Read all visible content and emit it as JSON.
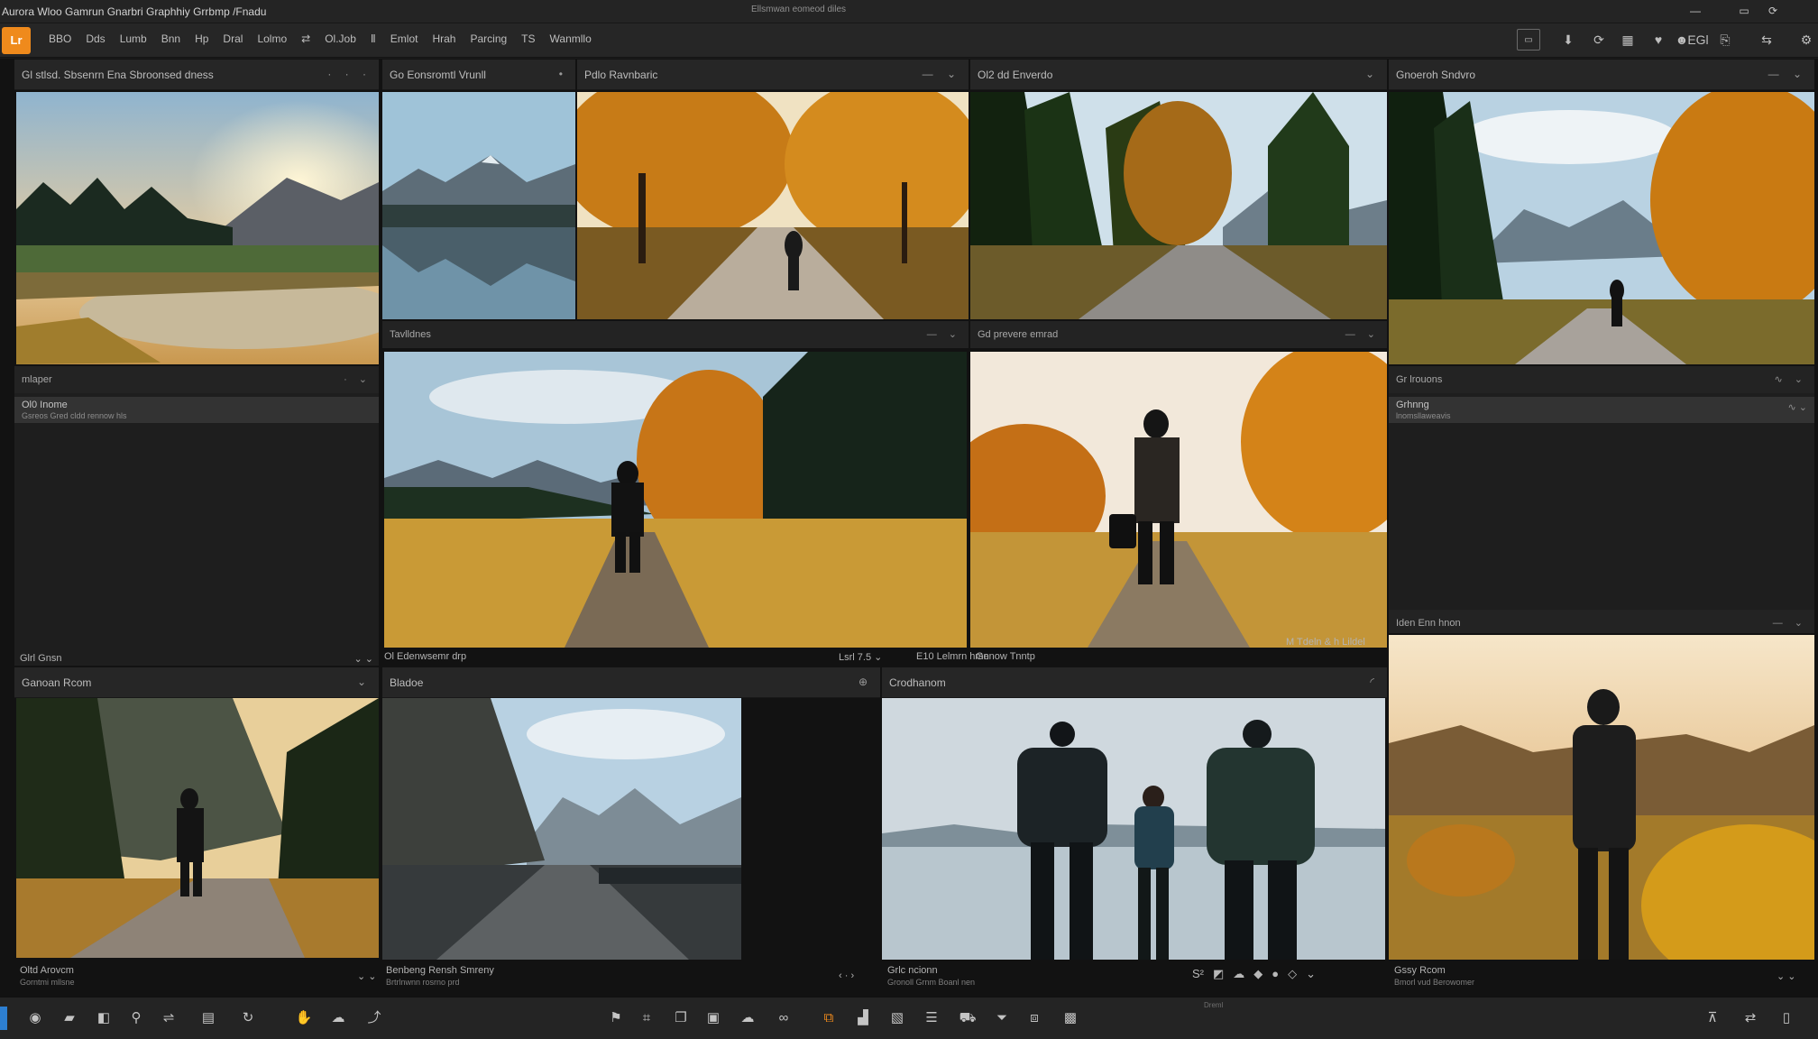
{
  "titlebar": {
    "app_title": "Aurora Wloo Gamrun Gnarbri Graphhiy Grrbmp /Fnadu",
    "doc_title": "Ellsmwan eomeod diles",
    "buttons": [
      "—",
      "▭",
      "⟳"
    ]
  },
  "menubar": {
    "logo": "Lr",
    "items": [
      "BBO",
      "Dds",
      "Lumb",
      "Bnn",
      "Hp",
      "Dral",
      "Lolmo",
      "⇄",
      "Ol.Job",
      "Ⅱ",
      "Emlot",
      "Hrah",
      "Parcing",
      "TS",
      "Wanmllo"
    ],
    "right_icons": [
      {
        "icon": "display-icon",
        "glyph": "▭"
      },
      {
        "icon": "download-icon",
        "glyph": "⬇"
      },
      {
        "icon": "sync-icon",
        "glyph": "⟳"
      },
      {
        "icon": "grid-icon",
        "glyph": "▦"
      },
      {
        "icon": "heart-icon",
        "glyph": "♥"
      },
      {
        "icon": "user-icon",
        "glyph": "☻"
      },
      {
        "icon": "user-label",
        "glyph": "EGl"
      },
      {
        "icon": "export-icon",
        "glyph": "⎘"
      },
      {
        "icon": "share-icon",
        "glyph": "⇆"
      },
      {
        "icon": "settings-icon",
        "glyph": "⚙"
      }
    ]
  },
  "panels": {
    "p1": {
      "title": "Gl stlsd. Sbsenrn Ena Sbroonsed dness",
      "controls": "· · ·"
    },
    "p2": {
      "title": "Go Eonsromtl Vrunll",
      "controls": "•"
    },
    "p3": {
      "title": "Pdlo Ravnbaric",
      "controls": "— ⌄"
    },
    "p4": {
      "title": "Ol2 dd Enverdo",
      "controls": "⌄"
    },
    "p5": {
      "title": "Gnoeroh Sndvro",
      "controls": "— ⌄"
    },
    "sub_tavl": {
      "title": "Tavlldnes",
      "controls": "— ⌄"
    },
    "sub_preve": {
      "title": "Gd prevere emrad",
      "controls": "— ⌄"
    },
    "left_list": {
      "title": "mlaper",
      "controls": "· ⌄",
      "row_title": "Ol0 Inome",
      "row_sub": "Gsreos Gred cldd rennow hls",
      "footer": "Glrl Gnsn",
      "footer_ctrl": "⌄ ⌄"
    },
    "right_list": {
      "title": "Gr lrouons",
      "controls": "∿ ⌄",
      "row_title": "Grhnng",
      "row_sub": "lnomsllaweavis",
      "row_ctrl": "∿ ⌄"
    },
    "mid_cap_left": "Ol Edenwsemr drp",
    "mid_cap_left_ctrl": "Lsrl 7.5 ⌄",
    "mid_cap_right": "E10 Lelmrn hmn",
    "mid_cap_right_2": "Genow Tnntp",
    "mid_cap_right_ctrl": "M Tdeln & h Lildel",
    "right_mid_cap": "Iden Enn hnon",
    "right_mid_ctrl": "— ⌄",
    "b1": {
      "title": "Ganoan Rcom",
      "controls": "⌄"
    },
    "b2": {
      "title": "Bladoe",
      "controls": "⊕"
    },
    "b3": {
      "title": "Crodhanom",
      "controls": "◜"
    },
    "b1_cap": "Oltd Arovcm",
    "b1_sub": "Gorntmi mllsne",
    "b1_ctrl": "⌄ ⌄",
    "b2_cap": "Benbeng Rensh Smreny",
    "b2_sub": "Brtrlnwnn rosrno prd",
    "b2_ctrl": "‹ · ›",
    "b3_cap": "Grlc ncionn",
    "b3_sub": "Gronoll Grnm Boanl nen",
    "b4_cap": "Gssy Rcom",
    "b4_sub": "Bmorl vud Berowomer",
    "b4_ctrl": "⌄ ⌄",
    "b3_tools": [
      "S²",
      "◩",
      "☁",
      "◆",
      "●",
      "◇",
      "⌄"
    ]
  },
  "bottombar": {
    "status_hint": "Dreml",
    "left_icons": [
      {
        "icon": "library-icon",
        "glyph": "◉"
      },
      {
        "icon": "folder-icon",
        "glyph": "▰"
      },
      {
        "icon": "bag-icon",
        "glyph": "◧"
      },
      {
        "icon": "location-icon",
        "glyph": "⚲"
      },
      {
        "icon": "share-icon",
        "glyph": "⇌"
      },
      {
        "icon": "card-icon",
        "glyph": "▤"
      },
      {
        "icon": "sync-icon",
        "glyph": "↻"
      },
      {
        "icon": "hand-icon",
        "glyph": "✋"
      },
      {
        "icon": "cloud-icon",
        "glyph": "☁"
      },
      {
        "icon": "curve-icon",
        "glyph": "⤴"
      }
    ],
    "center_icons": [
      {
        "icon": "flag-icon",
        "glyph": "⚑"
      },
      {
        "icon": "crop-icon",
        "glyph": "⌗"
      },
      {
        "icon": "copy-icon",
        "glyph": "❐"
      },
      {
        "icon": "clipboard-icon",
        "glyph": "▣"
      },
      {
        "icon": "cloud-icon",
        "glyph": "☁"
      },
      {
        "icon": "link-icon",
        "glyph": "∞"
      },
      {
        "icon": "transform-icon",
        "glyph": "⧉"
      },
      {
        "icon": "chart-icon",
        "glyph": "▟"
      },
      {
        "icon": "image-icon",
        "glyph": "▧"
      },
      {
        "icon": "list-icon",
        "glyph": "☰"
      },
      {
        "icon": "car-icon",
        "glyph": "⛟"
      },
      {
        "icon": "funnel-icon",
        "glyph": "⏷"
      },
      {
        "icon": "stack-icon",
        "glyph": "⧈"
      },
      {
        "icon": "gallery-icon",
        "glyph": "▩"
      }
    ],
    "right_icons": [
      {
        "icon": "filter-icon",
        "glyph": "⊼"
      },
      {
        "icon": "swap-icon",
        "glyph": "⇄"
      },
      {
        "icon": "sidebar-icon",
        "glyph": "▯"
      }
    ]
  },
  "colors": {
    "accent": "#ef8a1c",
    "panel": "#262626",
    "background": "#121212",
    "selection": "#2d7fd1"
  }
}
